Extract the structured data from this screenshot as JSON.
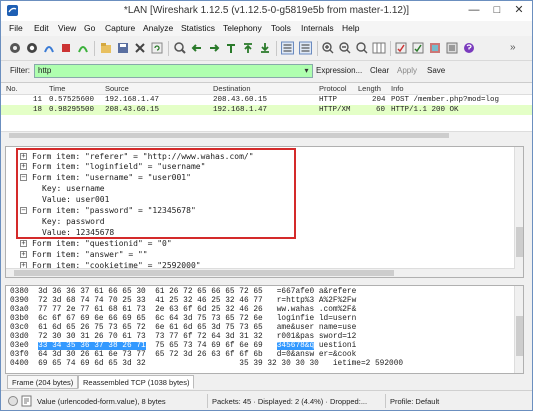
{
  "window": {
    "title": "*LAN [Wireshark 1.12.5 (v1.12.5-0-g5819e5b from master-1.12)]",
    "minimize": "—",
    "maximize": "□",
    "close": "✕"
  },
  "menu": [
    "File",
    "Edit",
    "View",
    "Go",
    "Capture",
    "Analyze",
    "Statistics",
    "Telephony",
    "Tools",
    "Internals",
    "Help"
  ],
  "toolbar": {
    "icons": [
      "interface-list-icon",
      "capture-options-icon",
      "start-capture-icon",
      "stop-capture-icon",
      "restart-capture-icon",
      "open-file-icon",
      "save-file-icon",
      "close-file-icon",
      "reload-icon",
      "find-packet-icon",
      "go-back-icon",
      "go-forward-icon",
      "go-to-packet-icon",
      "go-first-icon",
      "go-last-icon",
      "colorize-icon",
      "auto-scroll-icon",
      "zoom-in-icon",
      "zoom-out-icon",
      "zoom-normal-icon",
      "resize-columns-icon",
      "capture-filters-icon",
      "display-filters-icon",
      "coloring-rules-icon",
      "preferences-icon",
      "help-icon"
    ],
    "overflow": "»"
  },
  "filter": {
    "label": "Filter:",
    "value": "http",
    "expression": "Expression...",
    "clear": "Clear",
    "apply": "Apply",
    "save": "Save",
    "bg_color": "#afffaf"
  },
  "packet_list": {
    "columns": [
      "No.",
      "Time",
      "Source",
      "Destination",
      "Protocol",
      "Length",
      "Info"
    ],
    "rows": [
      {
        "no": "11",
        "time": "0.57525600",
        "source": "192.168.1.47",
        "destination": "208.43.60.15",
        "protocol": "HTTP",
        "length": "204",
        "info": "POST /member.php?mod=log",
        "selected": false
      },
      {
        "no": "18",
        "time": "0.98295500",
        "source": "208.43.60.15",
        "destination": "192.168.1.47",
        "protocol": "HTTP/XM",
        "length": "60",
        "info": "HTTP/1.1 200 OK",
        "selected": true
      }
    ]
  },
  "details": {
    "lines": [
      {
        "indent": 0,
        "exp": "+",
        "text": "Form item: \"referer\" = \"http://www.wahas.com/\""
      },
      {
        "indent": 0,
        "exp": "+",
        "text": "Form item: \"loginfield\" = \"username\""
      },
      {
        "indent": 0,
        "exp": "−",
        "text": "Form item: \"username\" = \"user001\""
      },
      {
        "indent": 1,
        "exp": "",
        "text": "Key: username"
      },
      {
        "indent": 1,
        "exp": "",
        "text": "Value: user001"
      },
      {
        "indent": 0,
        "exp": "−",
        "text": "Form item: \"password\" = \"12345678\""
      },
      {
        "indent": 1,
        "exp": "",
        "text": "Key: password"
      },
      {
        "indent": 1,
        "exp": "",
        "text": "Value: 12345678"
      },
      {
        "indent": 0,
        "exp": "+",
        "text": "Form item: \"questionid\" = \"0\""
      },
      {
        "indent": 0,
        "exp": "+",
        "text": "Form item: \"answer\" = \"\""
      },
      {
        "indent": 0,
        "exp": "+",
        "text": "Form item: \"cookietime\" = \"2592000\""
      }
    ]
  },
  "bytes": {
    "rows": [
      {
        "offset": "0380",
        "hex1": "3d 36 36 37 61 66 65 30",
        "hex2": "61 26 72 65 66 65 72 65",
        "ascii1": "=667afe0",
        "ascii2": "a&refere"
      },
      {
        "offset": "0390",
        "hex1": "72 3d 68 74 74 70 25 33",
        "hex2": "41 25 32 46 25 32 46 77",
        "ascii1": "r=http%3",
        "ascii2": "A%2F%2Fw"
      },
      {
        "offset": "03a0",
        "hex1": "77 77 2e 77 61 68 61 73",
        "hex2": "2e 63 6f 6d 25 32 46 26",
        "ascii1": "ww.wahas",
        "ascii2": ".com%2F&"
      },
      {
        "offset": "03b0",
        "hex1": "6c 6f 67 69 6e 66 69 65",
        "hex2": "6c 64 3d 75 73 65 72 6e",
        "ascii1": "loginfie",
        "ascii2": "ld=usern"
      },
      {
        "offset": "03c0",
        "hex1": "61 6d 65 26 75 73 65 72",
        "hex2": "6e 61 6d 65 3d 75 73 65",
        "ascii1": "ame&user",
        "ascii2": "name=use"
      },
      {
        "offset": "03d0",
        "hex1": "72 30 30 31 26 70 61 73",
        "hex2": "73 77 6f 72 64 3d 31 32",
        "ascii1": "r001&pas",
        "ascii2": "sword=12"
      },
      {
        "offset": "03e0",
        "hex1": "33 34 35 36 37 38 26 71",
        "hex2": "75 65 73 74 69 6f 6e 69",
        "ascii1": "345678&q",
        "ascii2": "uestioni"
      },
      {
        "offset": "03f0",
        "hex1": "64 3d 30 26 61 6e 73 77",
        "hex2": "65 72 3d 26 63 6f 6f 6b",
        "ascii1": "d=0&answ",
        "ascii2": "er=&cook"
      },
      {
        "offset": "0400",
        "hex1": "69 65 74 69 6d 65 3d 32",
        "hex2": "35 39 32 30 30 30",
        "ascii1": "ietime=2",
        "ascii2": "592000"
      }
    ],
    "highlight_color": "#3399ff"
  },
  "tabs": [
    "Frame (204 bytes)",
    "Reassembled TCP (1038 bytes)"
  ],
  "status": {
    "field": "Value (urlencoded-form.value), 8 bytes",
    "packets": "Packets: 45 · Displayed: 2 (4.4%) · Dropped:...",
    "profile": "Profile: Default"
  }
}
